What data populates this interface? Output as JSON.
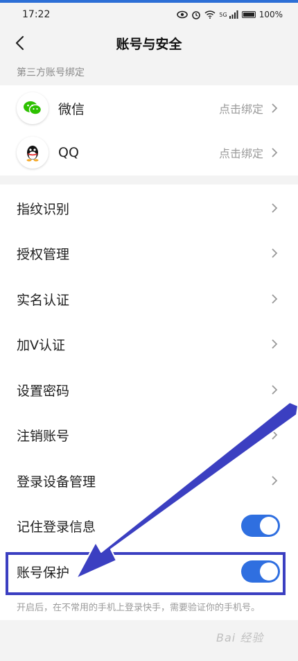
{
  "status_bar": {
    "time": "17:22",
    "signal_label": "5G",
    "battery": "100%"
  },
  "header": {
    "title": "账号与安全"
  },
  "third_party": {
    "section_title": "第三方账号绑定",
    "items": [
      {
        "name": "微信",
        "action": "点击绑定",
        "icon": "wechat-icon"
      },
      {
        "name": "QQ",
        "action": "点击绑定",
        "icon": "qq-icon"
      }
    ]
  },
  "settings": {
    "items": [
      {
        "label": "指纹识别"
      },
      {
        "label": "授权管理"
      },
      {
        "label": "实名认证"
      },
      {
        "label": "加V认证"
      },
      {
        "label": "设置密码"
      },
      {
        "label": "注销账号"
      },
      {
        "label": "登录设备管理"
      },
      {
        "label": "记住登录信息",
        "toggle": true
      },
      {
        "label": "账号保护",
        "toggle": true
      }
    ]
  },
  "footnote": "开启后，在不常用的手机上登录快手，需要验证你的手机号。",
  "watermark": "Bai 经验",
  "colors": {
    "accent": "#2f6fe0",
    "highlight": "#3b3fc1",
    "arrow": "#3b3fc1"
  }
}
